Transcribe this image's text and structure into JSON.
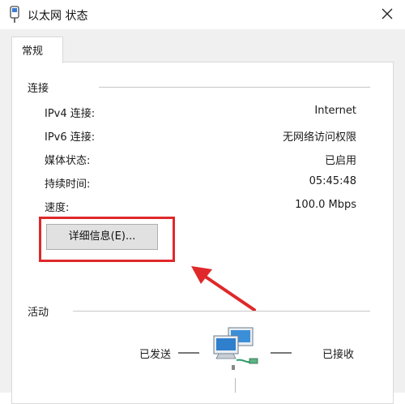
{
  "window": {
    "title": "以太网 状态"
  },
  "tabs": [
    {
      "label": "常规",
      "selected": true
    }
  ],
  "connection": {
    "section_title": "连接",
    "rows": [
      {
        "label": "IPv4 连接:",
        "value": "Internet"
      },
      {
        "label": "IPv6 连接:",
        "value": "无网络访问权限"
      },
      {
        "label": "媒体状态:",
        "value": "已启用"
      },
      {
        "label": "持续时间:",
        "value": "05:45:48"
      },
      {
        "label": "速度:",
        "value": "100.0 Mbps"
      }
    ],
    "details_button": "详细信息(E)..."
  },
  "activity": {
    "section_title": "活动",
    "sent_label": "已发送",
    "received_label": "已接收"
  },
  "annotation": {
    "highlight_color": "#e0282a"
  },
  "icons": [
    "ethernet-icon",
    "close-icon",
    "network-computers-icon"
  ]
}
